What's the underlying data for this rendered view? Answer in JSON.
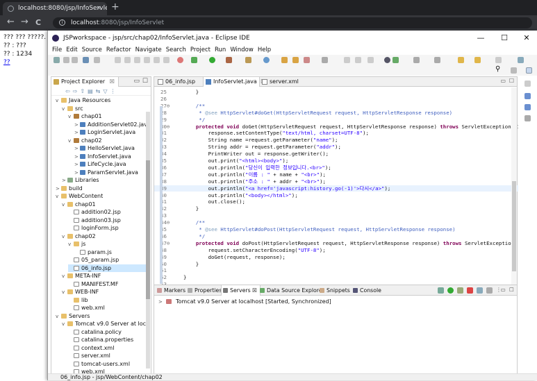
{
  "browser": {
    "tab_title": "localhost:8080/jsp/InfoServlet",
    "tab_close": "×",
    "new_tab": "+",
    "back": "←",
    "forward": "→",
    "reload": "C",
    "url_host": "localhost",
    "url_rest": ":8080/jsp/InfoServlet",
    "info_glyph": "i"
  },
  "page": {
    "line1": "??? ??? ?????.",
    "line2": "?? : ???",
    "line3": "?? : 1234",
    "link": "??"
  },
  "eclipse": {
    "title": "JSPworkspace - jsp/src/chap02/InfoServlet.java - Eclipse IDE",
    "win_min": "—",
    "win_max": "☐",
    "win_close": "✕",
    "menu": [
      "File",
      "Edit",
      "Source",
      "Refactor",
      "Navigate",
      "Search",
      "Project",
      "Run",
      "Window",
      "Help"
    ],
    "project_explorer": {
      "tab": "Project Explorer",
      "tab_close": "☒",
      "items": [
        {
          "level": 0,
          "arrow": "v",
          "icon": "folder",
          "label": "Java Resources"
        },
        {
          "level": 1,
          "arrow": "v",
          "icon": "folder",
          "label": "src"
        },
        {
          "level": 2,
          "arrow": "v",
          "icon": "pkg",
          "label": "chap01"
        },
        {
          "level": 3,
          "arrow": ">",
          "icon": "java",
          "label": "AdditionServlet02.java"
        },
        {
          "level": 3,
          "arrow": ">",
          "icon": "java",
          "label": "LoginServlet.java"
        },
        {
          "level": 2,
          "arrow": "v",
          "icon": "pkg",
          "label": "chap02"
        },
        {
          "level": 3,
          "arrow": ">",
          "icon": "java",
          "label": "HelloServlet.java"
        },
        {
          "level": 3,
          "arrow": ">",
          "icon": "java",
          "label": "InfoServlet.java"
        },
        {
          "level": 3,
          "arrow": ">",
          "icon": "java",
          "label": "LifeCycle.java"
        },
        {
          "level": 3,
          "arrow": ">",
          "icon": "java",
          "label": "ParamServlet.java"
        },
        {
          "level": 1,
          "arrow": ">",
          "icon": "lib",
          "label": "Libraries"
        },
        {
          "level": 0,
          "arrow": ">",
          "icon": "folder",
          "label": "build"
        },
        {
          "level": 0,
          "arrow": "v",
          "icon": "folder",
          "label": "WebContent"
        },
        {
          "level": 1,
          "arrow": "v",
          "icon": "folder",
          "label": "chap01"
        },
        {
          "level": 2,
          "arrow": "",
          "icon": "file",
          "label": "addition02.jsp"
        },
        {
          "level": 2,
          "arrow": "",
          "icon": "file",
          "label": "addition03.jsp"
        },
        {
          "level": 2,
          "arrow": "",
          "icon": "file",
          "label": "loginForm.jsp"
        },
        {
          "level": 1,
          "arrow": "v",
          "icon": "folder",
          "label": "chap02"
        },
        {
          "level": 2,
          "arrow": "v",
          "icon": "folder",
          "label": "js"
        },
        {
          "level": 3,
          "arrow": "",
          "icon": "file",
          "label": "param.js"
        },
        {
          "level": 2,
          "arrow": "",
          "icon": "file",
          "label": "05_param.jsp"
        },
        {
          "level": 2,
          "arrow": "",
          "icon": "file",
          "label": "06_info.jsp"
        },
        {
          "level": 1,
          "arrow": "v",
          "icon": "folder",
          "label": "META-INF"
        },
        {
          "level": 2,
          "arrow": "",
          "icon": "file",
          "label": "MANIFEST.MF"
        },
        {
          "level": 1,
          "arrow": "v",
          "icon": "folder",
          "label": "WEB-INF"
        },
        {
          "level": 2,
          "arrow": "",
          "icon": "folder",
          "label": "lib"
        },
        {
          "level": 2,
          "arrow": "",
          "icon": "xml",
          "label": "web.xml"
        },
        {
          "level": 0,
          "arrow": "v",
          "icon": "folder",
          "label": "Servers"
        },
        {
          "level": 1,
          "arrow": "v",
          "icon": "folder",
          "label": "Tomcat v9.0 Server at localhost-config"
        },
        {
          "level": 2,
          "arrow": "",
          "icon": "file",
          "label": "catalina.policy"
        },
        {
          "level": 2,
          "arrow": "",
          "icon": "file",
          "label": "catalina.properties"
        },
        {
          "level": 2,
          "arrow": "",
          "icon": "xml",
          "label": "context.xml"
        },
        {
          "level": 2,
          "arrow": "",
          "icon": "xml",
          "label": "server.xml"
        },
        {
          "level": 2,
          "arrow": "",
          "icon": "xml",
          "label": "tomcat-users.xml"
        },
        {
          "level": 2,
          "arrow": "",
          "icon": "xml",
          "label": "web.xml"
        }
      ]
    },
    "editor_tabs": [
      "06_info.jsp",
      "InfoServlet.java",
      "server.xml"
    ],
    "editor_tab_close": "☒",
    "code_lines": [
      {
        "n": "25",
        "t": "    }"
      },
      {
        "n": "26",
        "t": ""
      },
      {
        "n": "27⊖",
        "t": "    /**"
      },
      {
        "n": "28",
        "t": "     * @see HttpServlet#doGet(HttpServletRequest request, HttpServletResponse response)"
      },
      {
        "n": "29",
        "t": "     */"
      },
      {
        "n": "30⊖",
        "t": "    protected void doGet(HttpServletRequest request, HttpServletResponse response) throws ServletException, IOEx"
      },
      {
        "n": "31",
        "t": "        response.setContentType(\"text/html, charset=UTF-8\");"
      },
      {
        "n": "32",
        "t": "        String name =request.getParameter(\"name\");"
      },
      {
        "n": "33",
        "t": "        String addr = request.getParameter(\"addr\");"
      },
      {
        "n": "34",
        "t": "        PrintWriter out = response.getWriter();"
      },
      {
        "n": "35",
        "t": "        out.print(\"<html><body>\");"
      },
      {
        "n": "36",
        "t": "        out.println(\"당신이 입력한 정보입니다.<br>\");"
      },
      {
        "n": "37",
        "t": "        out.println(\"이름 : \" + name + \"<br>\");"
      },
      {
        "n": "38",
        "t": "        out.println(\"주소 : \" + addr + \"<br>\");"
      },
      {
        "n": "39",
        "t": "        out.println(\"<a href='javascript:history.go(-1)'>다시</a>\");"
      },
      {
        "n": "40",
        "t": "        out.println(\"<body></html>\");"
      },
      {
        "n": "41",
        "t": "        out.close();"
      },
      {
        "n": "42",
        "t": "    }"
      },
      {
        "n": "43",
        "t": ""
      },
      {
        "n": "44⊖",
        "t": "    /**"
      },
      {
        "n": "45",
        "t": "     * @see HttpServlet#doPost(HttpServletRequest request, HttpServletResponse response)"
      },
      {
        "n": "46",
        "t": "     */"
      },
      {
        "n": "47⊖",
        "t": "    protected void doPost(HttpServletRequest request, HttpServletResponse response) throws ServletException, IOE"
      },
      {
        "n": "48",
        "t": "        request.setCharacterEncoding(\"UTF-8\");"
      },
      {
        "n": "49",
        "t": "        doGet(request, response);"
      },
      {
        "n": "50",
        "t": "    }"
      },
      {
        "n": "51",
        "t": ""
      },
      {
        "n": "52",
        "t": "}"
      },
      {
        "n": "53",
        "t": ""
      }
    ],
    "bottom_tabs": [
      "Markers",
      "Properties",
      "Servers",
      "Data Source Explorer",
      "Snippets",
      "Console"
    ],
    "server_entry": "Tomcat v9.0 Server at localhost  [Started, Synchronized]",
    "status": "06_info.jsp - jsp/WebContent/chap02"
  }
}
